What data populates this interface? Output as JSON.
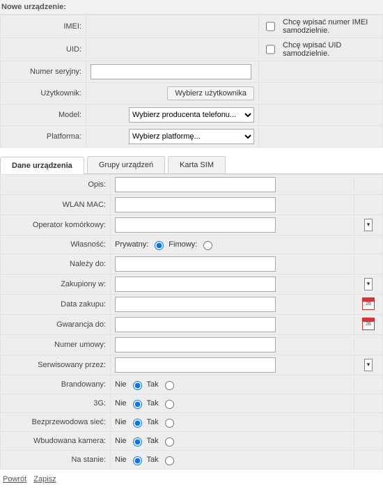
{
  "title": "Nowe urządzenie:",
  "top": {
    "imei_label": "IMEI:",
    "imei_value": "",
    "imei_chk_label": "Chcę wpisać numer IMEI samodzielnie.",
    "uid_label": "UID:",
    "uid_value": "",
    "uid_chk_label": "Chcę wpisać UID samodzielnie.",
    "serial_label": "Numer seryjny:",
    "serial_value": "",
    "user_label": "Użytkownik:",
    "user_btn": "Wybierz użytkownika",
    "model_label": "Model:",
    "model_select": "Wybierz producenta telefonu...",
    "platform_label": "Platforma:",
    "platform_select": "Wybierz platformę..."
  },
  "tabs": {
    "t0": "Dane urządzenia",
    "t1": "Grupy urządzeń",
    "t2": "Karta SIM"
  },
  "d": {
    "desc_label": "Opis:",
    "wlan_label": "WLAN MAC:",
    "op_label": "Operator komórkowy:",
    "own_label": "Własność:",
    "own_priv": "Prywatny:",
    "own_firm": "Fimowy:",
    "belongs_label": "Należy do:",
    "bought_label": "Zakupiony w:",
    "date_label": "Data zakupu:",
    "warr_label": "Gwarancja do:",
    "contract_label": "Numer umowy:",
    "serv_label": "Serwisowany przez:",
    "brand_label": "Brandowany:",
    "g3_label": "3G:",
    "wifi_label": "Bezprzewodowa sieć:",
    "cam_label": "Wbudowana kamera:",
    "stock_label": "Na stanie:",
    "no": "Nie",
    "yes": "Tak"
  },
  "footer": {
    "back": "Powrót",
    "save": "Zapisz"
  }
}
